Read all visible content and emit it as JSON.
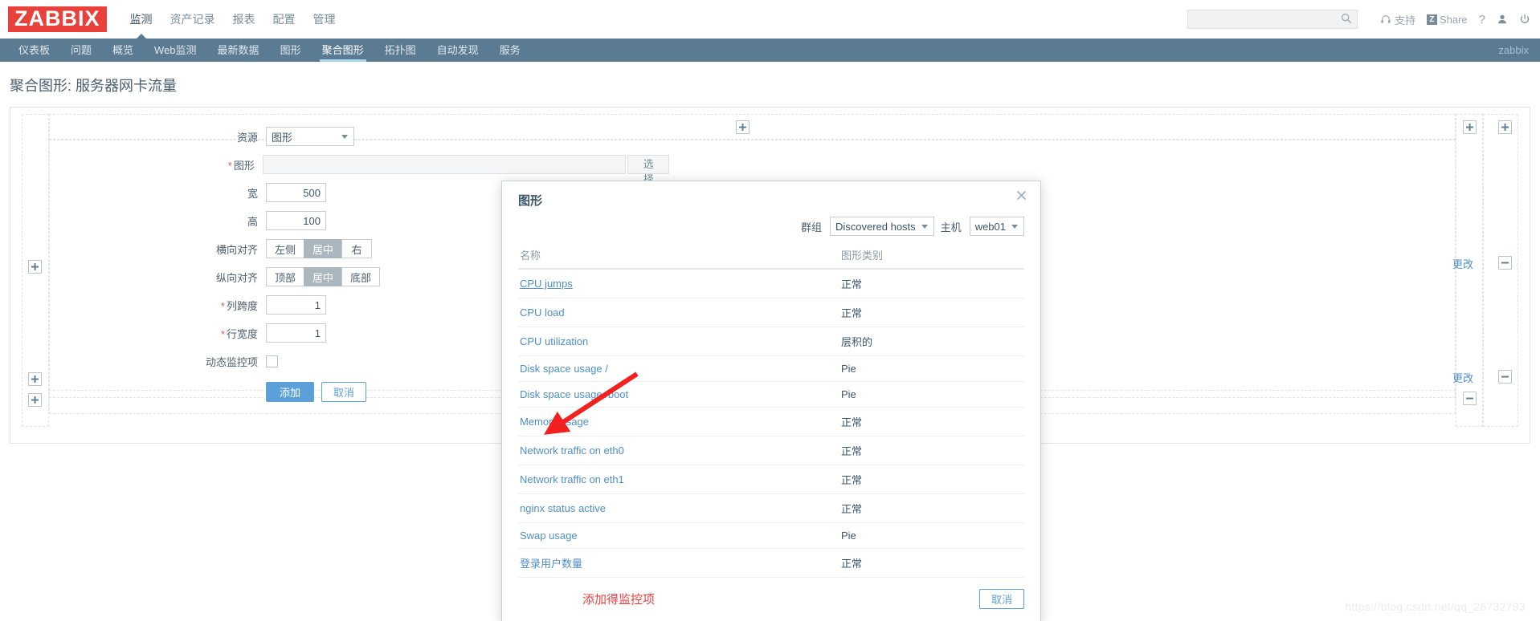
{
  "header": {
    "logo": "ZABBIX",
    "main_nav": [
      {
        "label": "监测",
        "active": true
      },
      {
        "label": "资产记录",
        "active": false
      },
      {
        "label": "报表",
        "active": false
      },
      {
        "label": "配置",
        "active": false
      },
      {
        "label": "管理",
        "active": false
      }
    ],
    "search": {
      "value": "",
      "placeholder": ""
    },
    "support_label": "支持",
    "share_label": "Share",
    "share_badge": "Z",
    "help_label": "?",
    "user_label": "",
    "signout_label": ""
  },
  "subnav": {
    "items": [
      {
        "label": "仪表板",
        "active": false
      },
      {
        "label": "问题",
        "active": false
      },
      {
        "label": "概览",
        "active": false
      },
      {
        "label": "Web监测",
        "active": false
      },
      {
        "label": "最新数据",
        "active": false
      },
      {
        "label": "图形",
        "active": false
      },
      {
        "label": "聚合图形",
        "active": true
      },
      {
        "label": "拓扑图",
        "active": false
      },
      {
        "label": "自动发现",
        "active": false
      },
      {
        "label": "服务",
        "active": false
      }
    ],
    "user": "zabbix"
  },
  "page": {
    "title": "聚合图形: 服务器网卡流量"
  },
  "cell_form": {
    "resource_label": "资源",
    "resource_value": "图形",
    "graph_label": "图形",
    "graph_value": "",
    "graph_placeholder": "",
    "select_button": "选择",
    "width_label": "宽",
    "width_value": "500",
    "height_label": "高",
    "height_value": "100",
    "halign_label": "横向对齐",
    "halign_options": [
      "左侧",
      "居中",
      "右"
    ],
    "halign_selected": "居中",
    "valign_label": "纵向对齐",
    "valign_options": [
      "顶部",
      "居中",
      "底部"
    ],
    "valign_selected": "居中",
    "colspan_label": "列跨度",
    "colspan_value": "1",
    "rowspan_label": "行宽度",
    "rowspan_value": "1",
    "dynamic_label": "动态监控项",
    "dynamic_checked": false,
    "add_button": "添加",
    "cancel_button": "取消"
  },
  "grid": {
    "change_label": "更改",
    "plus_label": "+",
    "minus_label": "−"
  },
  "modal": {
    "title": "图形",
    "close_icon": "close-icon",
    "group_label": "群组",
    "group_value": "Discovered hosts",
    "host_label": "主机",
    "host_value": "web01",
    "columns": {
      "name": "名称",
      "type": "图形类别"
    },
    "rows": [
      {
        "name": "CPU jumps",
        "type": "正常"
      },
      {
        "name": "CPU load",
        "type": "正常"
      },
      {
        "name": "CPU utilization",
        "type": "层积的"
      },
      {
        "name": "Disk space usage /",
        "type": "Pie"
      },
      {
        "name": "Disk space usage /boot",
        "type": "Pie"
      },
      {
        "name": "Memory usage",
        "type": "正常"
      },
      {
        "name": "Network traffic on eth0",
        "type": "正常"
      },
      {
        "name": "Network traffic on eth1",
        "type": "正常"
      },
      {
        "name": "nginx status active",
        "type": "正常"
      },
      {
        "name": "Swap usage",
        "type": "Pie"
      },
      {
        "name": "登录用户数量",
        "type": "正常"
      }
    ],
    "annotation": "添加得监控项",
    "cancel_button": "取消"
  },
  "watermark": "https://blog.csdn.net/qq_26732793",
  "colors": {
    "brand_red": "#e8403a",
    "subnav_blue": "#5b7b93",
    "link_blue": "#4f8ec9",
    "annotation_red": "#ef4040",
    "primary_button": "#5ba0d8"
  }
}
